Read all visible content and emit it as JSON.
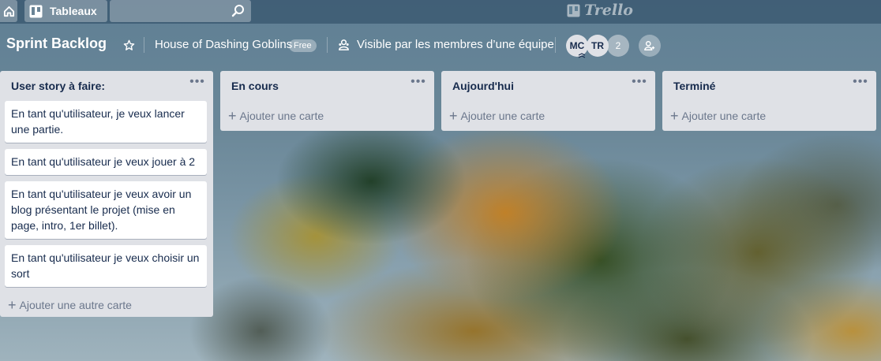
{
  "topbar": {
    "home_icon": "home-icon",
    "boards_label": "Tableaux",
    "boards_icon": "boards-icon",
    "search_value": "",
    "search_icon": "search-icon",
    "logo_text": "Trello"
  },
  "board": {
    "title": "Sprint Backlog",
    "team_name": "House of Dashing Goblins",
    "team_badge": "Free",
    "visibility": "Visible par les membres d’une équipe",
    "members": [
      "MC",
      "TR"
    ],
    "member_count": "2"
  },
  "lists": [
    {
      "title": "User story à faire:",
      "cards": [
        "En tant qu'utilisateur, je veux lancer une partie.",
        "En tant qu'utilisateur je veux jouer à 2",
        "En tant qu'utilisateur je veux avoir un blog présentant le projet (mise en page, intro, 1er billet).",
        "En tant qu'utilisateur je veux choisir un sort"
      ],
      "add_label": "Ajouter une autre carte"
    },
    {
      "title": "En cours",
      "cards": [],
      "add_label": "Ajouter une carte"
    },
    {
      "title": "Aujourd'hui",
      "cards": [],
      "add_label": "Ajouter une carte"
    },
    {
      "title": "Terminé",
      "cards": [],
      "add_label": "Ajouter une carte"
    }
  ],
  "colors": {
    "list_bg": "#dfe1e6",
    "card_text": "#172b4d",
    "muted_text": "#6b778c"
  }
}
